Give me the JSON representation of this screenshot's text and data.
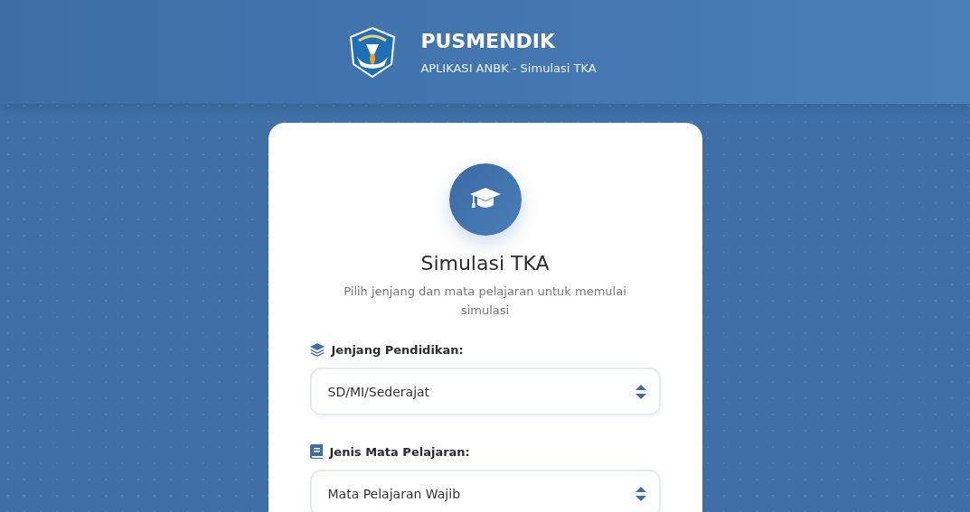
{
  "header": {
    "title": "PUSMENDIK",
    "subtitle": "APLIKASI ANBK - Simulasi TKA"
  },
  "card": {
    "title": "Simulasi TKA",
    "subtitle": "Pilih jenjang dan mata pelajaran untuk memulai simulasi",
    "fields": [
      {
        "kind": "select",
        "label": "Jenjang Pendidikan:",
        "value": "SD/MI/Sederajat"
      },
      {
        "kind": "select",
        "label": "Jenis Mata Pelajaran:",
        "value": "Mata Pelajaran Wajib"
      }
    ]
  }
}
